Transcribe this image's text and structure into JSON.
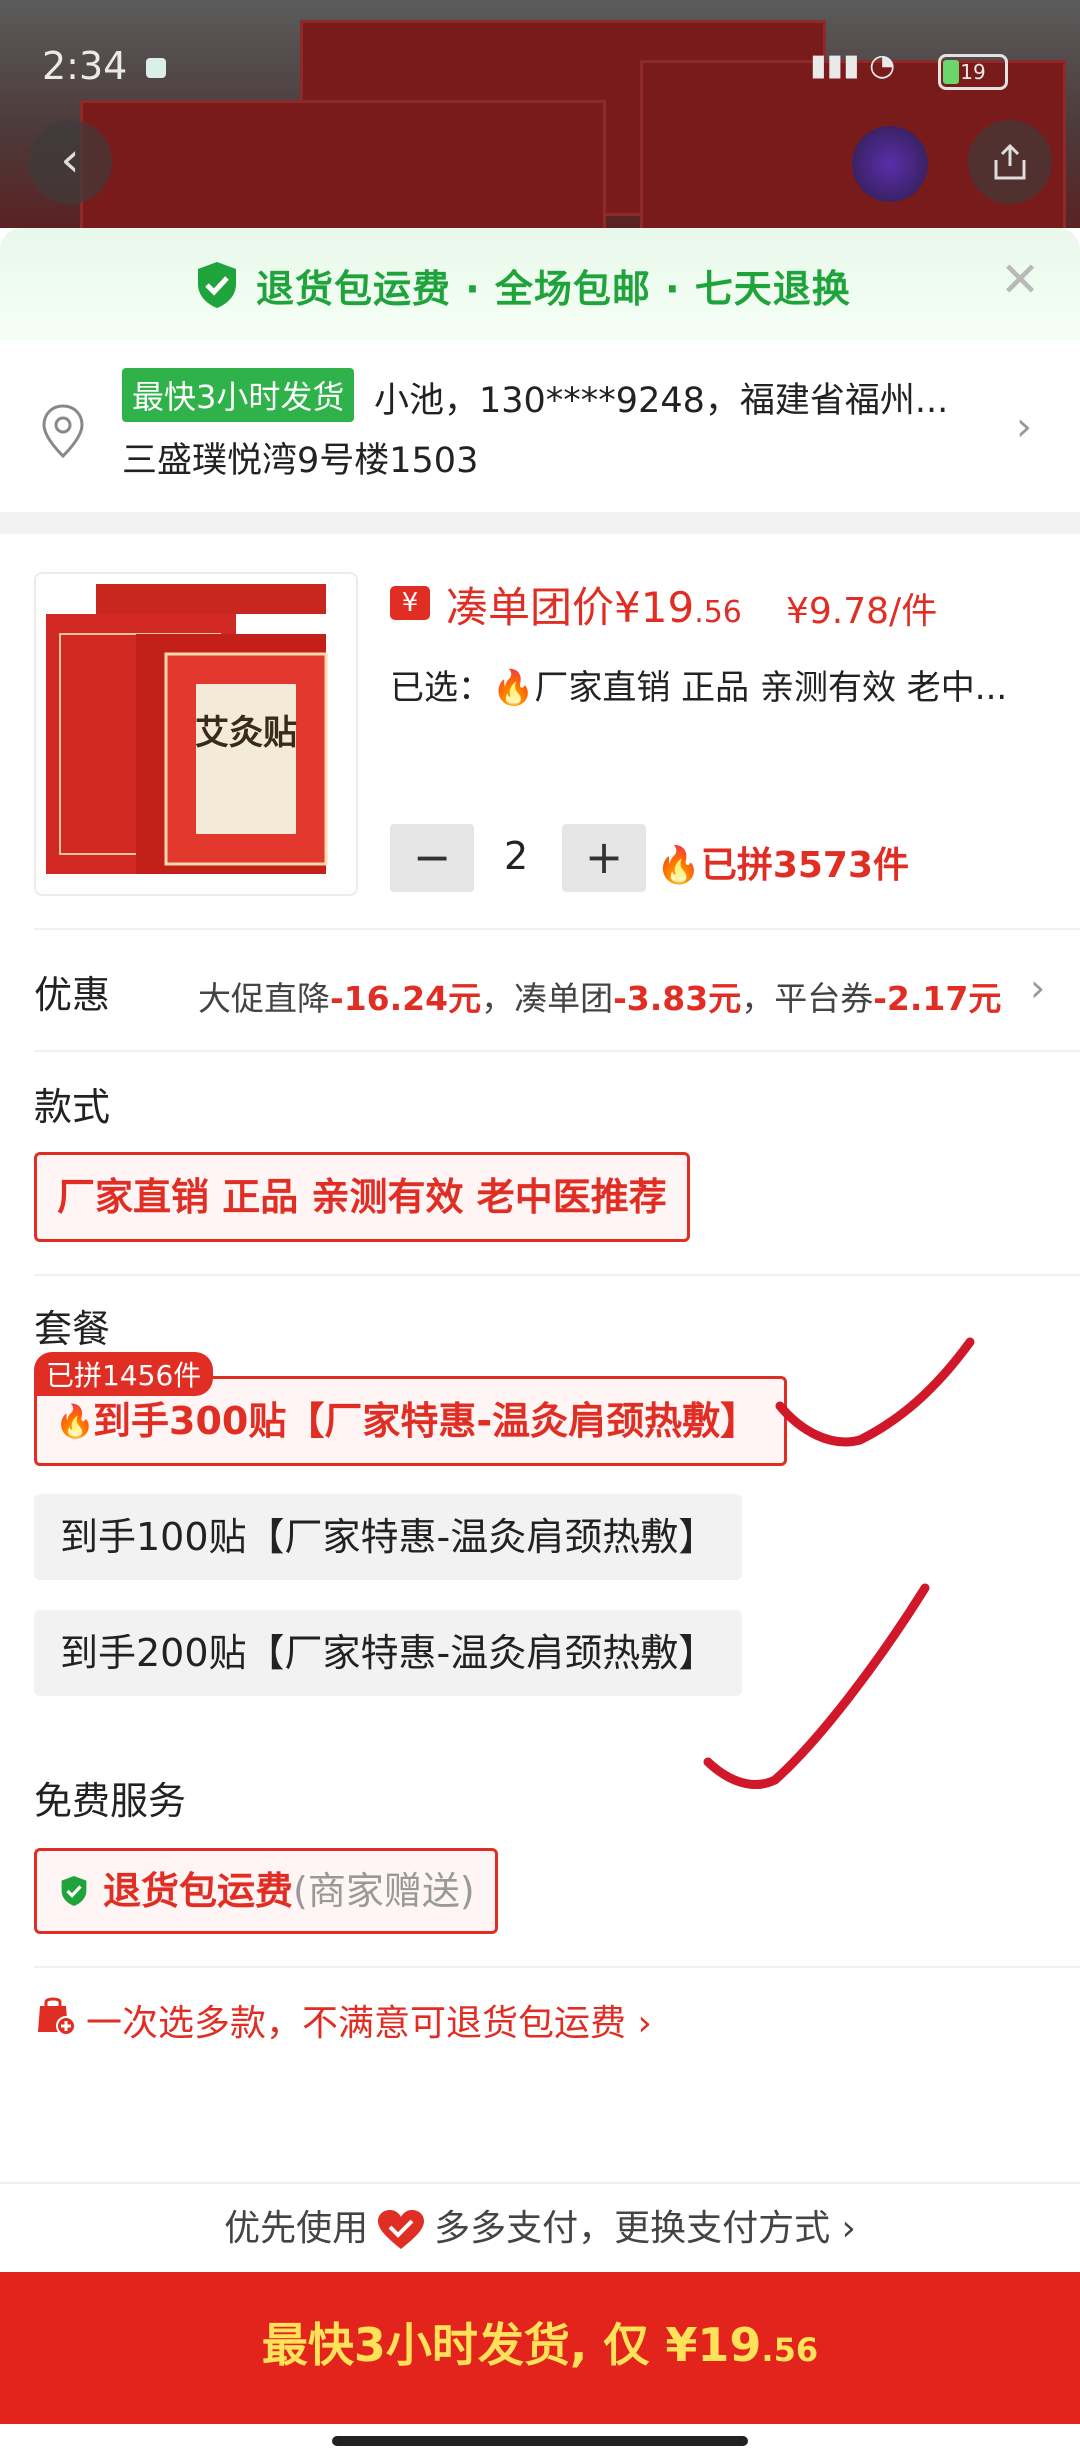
{
  "status_bar": {
    "time": "2:34",
    "battery": "19"
  },
  "guarantee": {
    "text": "退货包运费 · 全场包邮 · 七天退换"
  },
  "address": {
    "badge": "最快3小时发货",
    "line1": "小池，130****9248，福建省福州...",
    "line2": "三盛璞悦湾9号楼1503"
  },
  "product": {
    "price_prefix": "凑单团价¥",
    "price_main": "19",
    "price_decimal": ".56",
    "per_unit": "¥9.78/件",
    "selected_prefix": "已选：",
    "selected_value": "厂家直销 正品 亲测有效  老中...",
    "quantity": "2",
    "joined": "已拼3573件",
    "image_title": "艾灸贴"
  },
  "discount": {
    "title": "优惠",
    "p1_label": "大促直降",
    "p1_value": "-16.24元",
    "sep1": "，凑单团",
    "p2_value": "-3.83元",
    "sep2": "，平台券",
    "p3_value": "-2.17元"
  },
  "style_section": {
    "title": "款式",
    "option": "厂家直销 正品 亲测有效  老中医推荐"
  },
  "package_section": {
    "title": "套餐",
    "badge": "已拼1456件",
    "options": [
      "到手300贴【厂家特惠-温灸肩颈热敷】",
      "到手100贴【厂家特惠-温灸肩颈热敷】",
      "到手200贴【厂家特惠-温灸肩颈热敷】"
    ]
  },
  "service_section": {
    "title": "免费服务",
    "option_main": "退货包运费",
    "option_sub": "(商家赠送)"
  },
  "multi_select": {
    "text": "一次选多款，不满意可退货包运费 ›"
  },
  "payment": {
    "prefix": "优先使用",
    "text": "多多支付，更换支付方式 ›"
  },
  "buy_button": {
    "label": "最快3小时发货, 仅 ¥",
    "price_main": "19",
    "price_decimal": ".56"
  },
  "colors": {
    "accent": "#e02e24",
    "green": "#1fa33b",
    "buy_bg": "#e3241d",
    "buy_text": "#ffe25a"
  }
}
